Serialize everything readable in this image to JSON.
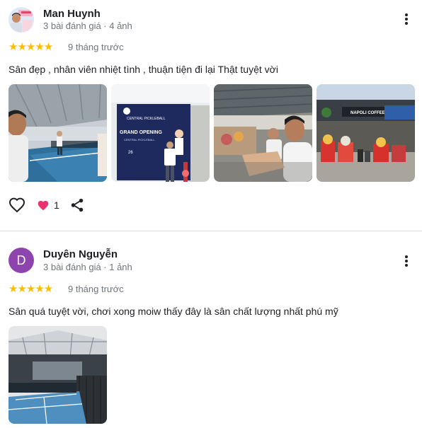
{
  "reviews": [
    {
      "name": "Man Huynh",
      "meta": "3 bài đánh giá · 4 ảnh",
      "stars": "★★★★★",
      "when": "9 tháng trước",
      "text": "Sân đẹp , nhân viên nhiệt tình , thuận tiện đi lại Thật tuyệt vời",
      "like_count": "1",
      "photos": [
        {
          "alt": "indoor pickleball court"
        },
        {
          "alt": "grand opening banner"
        },
        {
          "alt": "players seated"
        },
        {
          "alt": "entrance with lion dance"
        }
      ]
    },
    {
      "name": "Duyên Nguyễn",
      "avatar_letter": "D",
      "meta": "3 bài đánh giá · 1 ảnh",
      "stars": "★★★★★",
      "when": "9 tháng trước",
      "text": "Sân quá tuyệt vời, chơi xong moiw thấy đây là sân chất lượng nhất phú mỹ",
      "photos": [
        {
          "alt": "covered pickleball court"
        }
      ]
    }
  ],
  "banner_text": {
    "brand": "CENTRAL PICKLEBALL",
    "title": "GRAND OPENING",
    "sub": "CENTRAL PICKLEBALL",
    "date": "26"
  },
  "shop_sign": "NAPOLI COFFEE",
  "colors": {
    "star": "#fbbc04",
    "avatar_d": "#8e44ad",
    "like_heart": "#e8336e",
    "divider": "#dadce0"
  },
  "icons": [
    "more-vert-icon",
    "heart-outline-icon",
    "heart-filled-icon",
    "share-icon"
  ]
}
